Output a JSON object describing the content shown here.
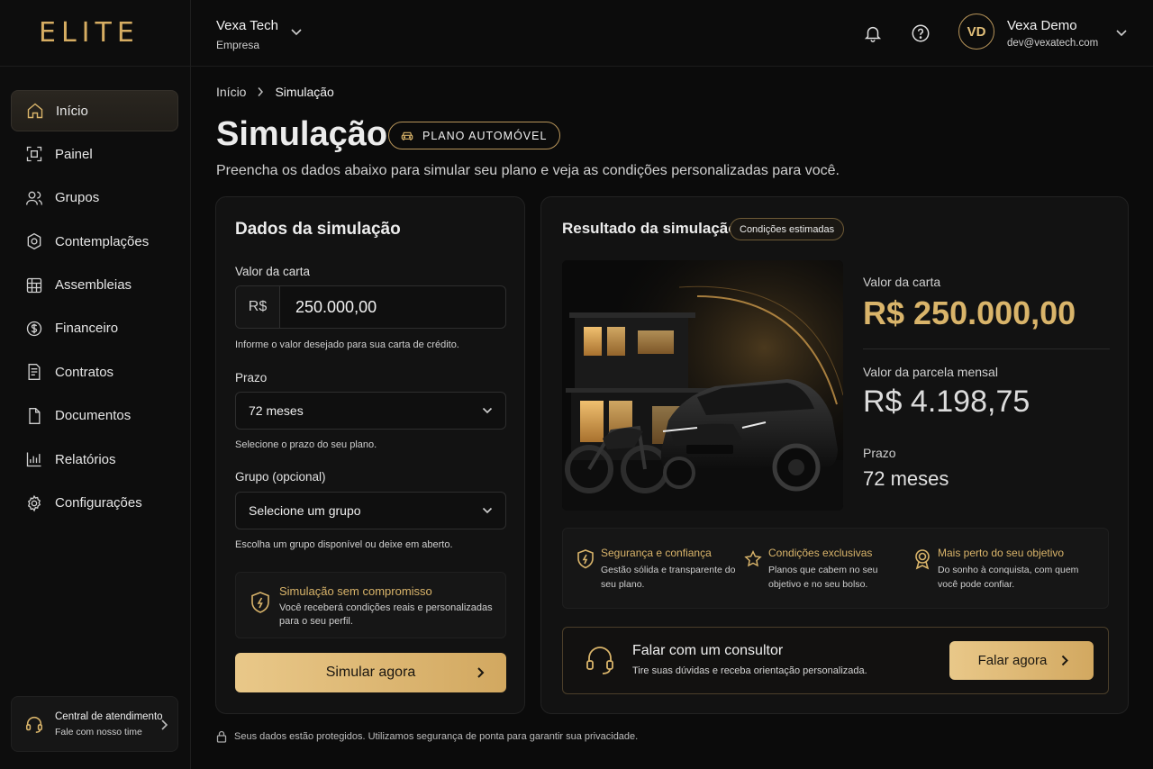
{
  "brand": {
    "logo": "ELITE",
    "accent": "#d9b46a"
  },
  "sidebar": {
    "items": [
      {
        "label": "Início",
        "icon": "home-icon",
        "active": true
      },
      {
        "label": "Painel",
        "icon": "dashboard-icon"
      },
      {
        "label": "Grupos",
        "icon": "users-icon"
      },
      {
        "label": "Contemplações",
        "icon": "badge-icon"
      },
      {
        "label": "Assembleias",
        "icon": "calendar-grid-icon"
      },
      {
        "label": "Financeiro",
        "icon": "dollar-circle-icon"
      },
      {
        "label": "Contratos",
        "icon": "contract-icon"
      },
      {
        "label": "Documentos",
        "icon": "document-icon"
      },
      {
        "label": "Relatórios",
        "icon": "chart-icon"
      },
      {
        "label": "Configurações",
        "icon": "gear-icon"
      }
    ],
    "support": {
      "title": "Central de atendimento",
      "subtitle": "Fale com nosso time"
    }
  },
  "header": {
    "company_name": "Vexa Tech",
    "company_type": "Empresa",
    "user_initials": "VD",
    "user_name": "Vexa Demo",
    "user_email": "dev@vexatech.com"
  },
  "breadcrumb": {
    "home": "Início",
    "current": "Simulação"
  },
  "page": {
    "title": "Simulação",
    "badge": "PLANO AUTOMÓVEL",
    "subtitle": "Preencha os dados abaixo para simular seu plano e veja as condições personalizadas para você."
  },
  "form": {
    "title": "Dados da simulação",
    "valor_label": "Valor da carta",
    "currency_prefix": "R$",
    "valor_value": "250.000,00",
    "valor_hint": "Informe o valor desejado para sua carta de crédito.",
    "prazo_label": "Prazo",
    "prazo_value": "72 meses",
    "prazo_hint": "Selecione o prazo do seu plano.",
    "grupo_label": "Grupo (opcional)",
    "grupo_value": "Selecione um grupo",
    "grupo_hint": "Escolha um grupo disponível ou deixe em aberto.",
    "notice_title": "Simulação sem compromisso",
    "notice_text": "Você receberá condições reais e personalizadas para o seu perfil.",
    "submit_label": "Simular agora"
  },
  "result": {
    "title": "Resultado da simulação",
    "chip": "Condições estimadas",
    "valor_label": "Valor da carta",
    "valor_value": "R$ 250.000,00",
    "parcela_label": "Valor da parcela mensal",
    "parcela_value": "R$ 4.198,75",
    "prazo_label": "Prazo",
    "prazo_value": "72 meses",
    "features": [
      {
        "title": "Segurança e confiança",
        "text": "Gestão sólida e transparente do seu plano.",
        "icon": "shield-icon"
      },
      {
        "title": "Condições exclusivas",
        "text": "Planos que cabem no seu objetivo e no seu bolso.",
        "icon": "star-icon"
      },
      {
        "title": "Mais perto do seu objetivo",
        "text": "Do sonho à conquista, com quem você pode confiar.",
        "icon": "medal-icon"
      }
    ],
    "consult_title": "Falar com um consultor",
    "consult_text": "Tire suas dúvidas e receba orientação personalizada.",
    "consult_button": "Falar agora"
  },
  "footer": {
    "note": "Seus dados estão protegidos. Utilizamos segurança de ponta para garantir sua privacidade."
  }
}
